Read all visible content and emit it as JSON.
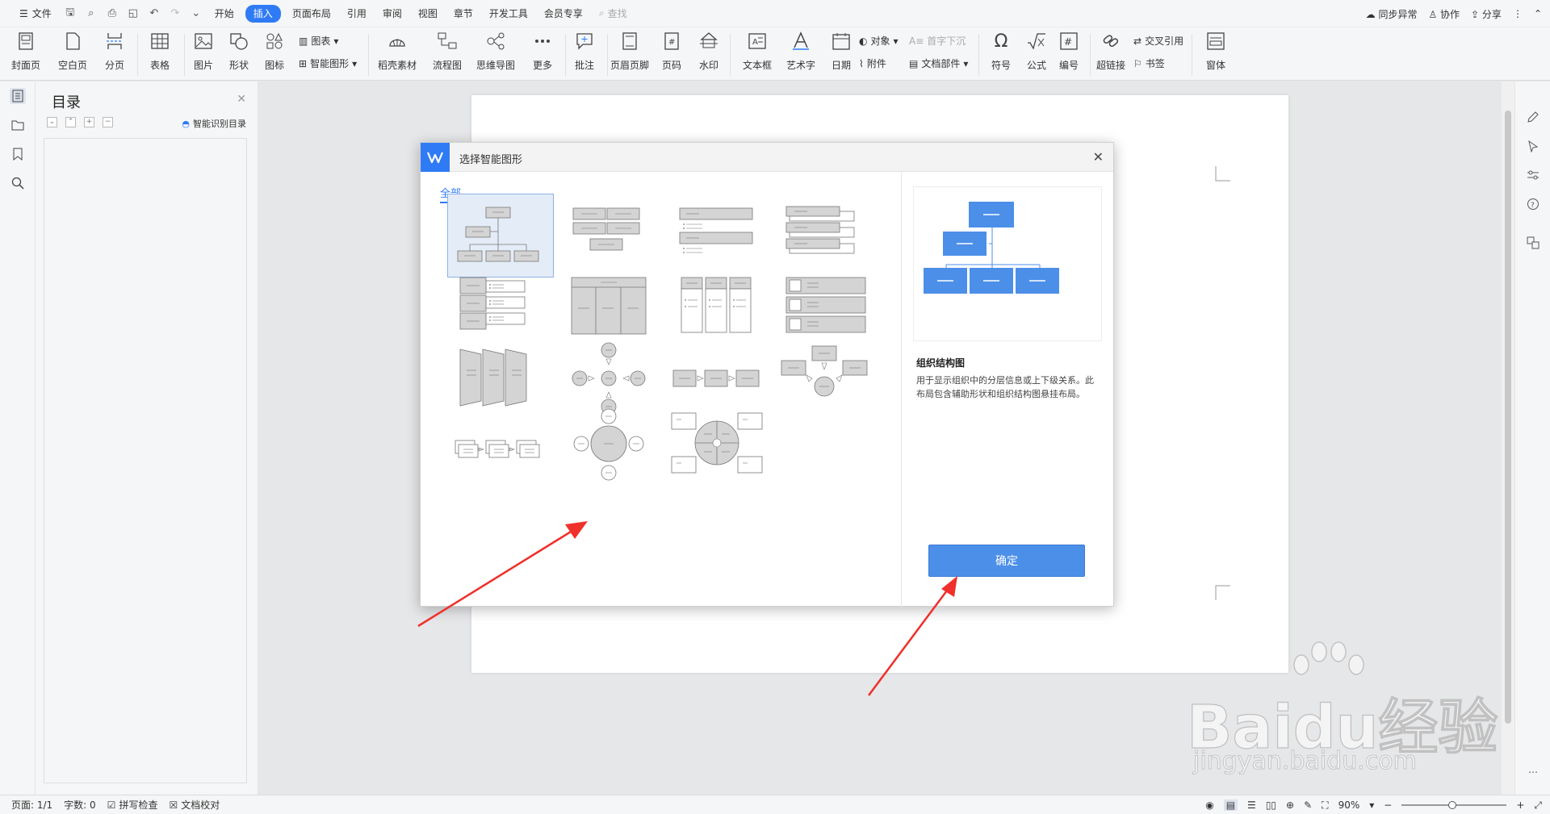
{
  "menu": {
    "file": "文件",
    "tabs": [
      "开始",
      "插入",
      "页面布局",
      "引用",
      "审阅",
      "视图",
      "章节",
      "开发工具",
      "会员专享"
    ],
    "active_tab": "插入",
    "search": "查找",
    "sync": "同步异常",
    "collab": "协作",
    "share": "分享"
  },
  "ribbon": {
    "cover": "封面页",
    "blank": "空白页",
    "pagebreak": "分页",
    "table": "表格",
    "picture": "图片",
    "shape": "形状",
    "icons": "图标",
    "chart": "图表",
    "smartart": "智能图形",
    "shell": "稻壳素材",
    "flowchart": "流程图",
    "mindmap": "思维导图",
    "more": "更多",
    "comment": "批注",
    "header_footer": "页眉页脚",
    "page_number": "页码",
    "watermark": "水印",
    "textbox": "文本框",
    "wordart": "艺术字",
    "date": "日期",
    "object": "对象",
    "attachment": "附件",
    "dropcap": "首字下沉",
    "docpart": "文档部件",
    "symbol": "符号",
    "formula": "公式",
    "numbering": "编号",
    "hyperlink": "超链接",
    "crossref": "交叉引用",
    "bookmark": "书签",
    "font": "窗体"
  },
  "toc": {
    "title": "目录",
    "smart": "智能识别目录"
  },
  "dialog": {
    "title": "选择智能图形",
    "tab_all": "全部",
    "preview_title": "组织结构图",
    "preview_desc": "用于显示组织中的分层信息或上下级关系。此布局包含辅助形状和组织结构图悬挂布局。",
    "ok": "确定"
  },
  "status": {
    "page": "页面: 1/1",
    "words": "字数: 0",
    "spell": "拼写检查",
    "proof": "文档校对",
    "zoom": "90%"
  },
  "watermark_text": {
    "brand": "Baidu经验",
    "url": "jingyan.baidu.com"
  },
  "colors": {
    "accent": "#2f7bf5",
    "ok_button": "#4c8fe8",
    "preview_fill": "#4c8fe8",
    "arrow": "#f0302a"
  }
}
